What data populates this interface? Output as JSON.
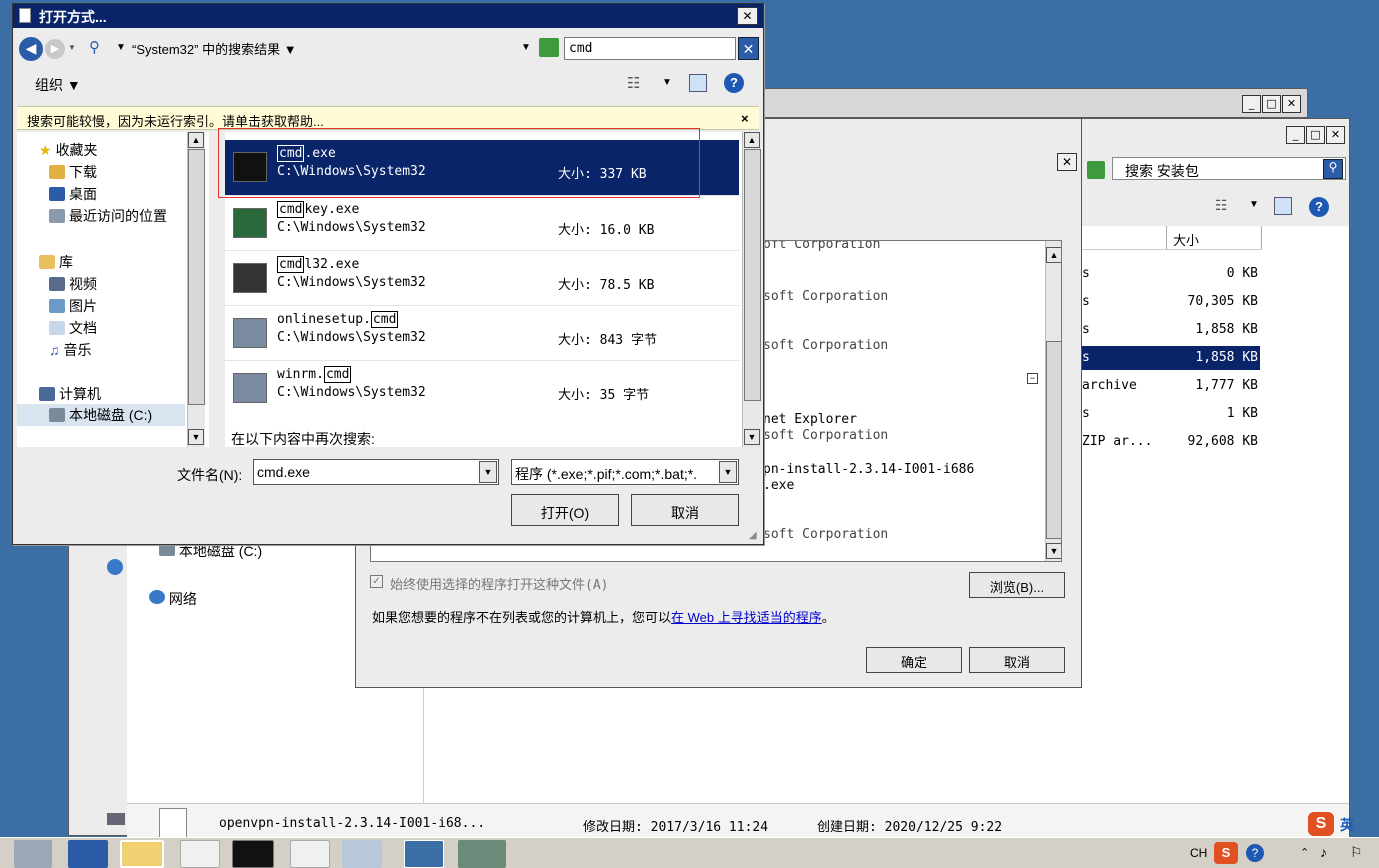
{
  "open_dialog": {
    "title": "打开方式...",
    "breadcrumb": "“System32” 中的搜索结果",
    "search_value": "cmd",
    "organize_label": "组织",
    "info_bar": "搜索可能较慢，因为未运行索引。请单击获取帮助...",
    "nav": {
      "favorites": "收藏夹",
      "downloads": "下载",
      "desktop": "桌面",
      "recent": "最近访问的位置",
      "libraries": "库",
      "videos": "视频",
      "pictures": "图片",
      "documents": "文档",
      "music": "音乐",
      "computer": "计算机",
      "local_disk": "本地磁盘 (C:)"
    },
    "results": [
      {
        "pre": "",
        "hl": "cmd",
        "post": ".exe",
        "path": "C:\\Windows\\System32",
        "size": "大小: 337 KB"
      },
      {
        "pre": "",
        "hl": "cmd",
        "post": "key.exe",
        "path": "C:\\Windows\\System32",
        "size": "大小: 16.0 KB"
      },
      {
        "pre": "",
        "hl": "cmd",
        "post": "l32.exe",
        "path": "C:\\Windows\\System32",
        "size": "大小: 78.5 KB"
      },
      {
        "pre": "onlinesetup.",
        "hl": "cmd",
        "post": "",
        "path": "C:\\Windows\\System32",
        "size": "大小: 843 字节"
      },
      {
        "pre": "winrm.",
        "hl": "cmd",
        "post": "",
        "path": "C:\\Windows\\System32",
        "size": "大小: 35 字节"
      }
    ],
    "search_again": "在以下内容中再次搜索:",
    "filename_label": "文件名(N):",
    "filename_value": "cmd.exe",
    "filter_value": "程序 (*.exe;*.pif;*.com;*.bat;*.",
    "open_button": "打开(O)",
    "cancel_button": "取消"
  },
  "openwith_dialog": {
    "list_fragments": [
      "oft Corporation",
      "soft Corporation",
      "soft Corporation",
      "net Explorer",
      "soft Corporation",
      "pn-install-2.3.14-I001-i686",
      ".exe",
      "soft Corporation"
    ],
    "always_use": "始终使用选择的程序打开这种文件(A)",
    "browse_button": "浏览(B)...",
    "hint_text": "如果您想要的程序不在列表或您的计算机上，您可以",
    "hint_link": "在 Web 上寻找适当的程序",
    "hint_end": "。",
    "ok_button": "确定",
    "cancel_button": "取消"
  },
  "explorer": {
    "search_placeholder": "搜索 安装包",
    "col_size": "大小",
    "files": [
      {
        "name": "s",
        "size": "0 KB"
      },
      {
        "name": "s",
        "size": "70,305 KB"
      },
      {
        "name": "s",
        "size": "1,858 KB"
      },
      {
        "name": "s",
        "size": "1,858 KB"
      },
      {
        "name": "archive",
        "size": "1,777 KB"
      },
      {
        "name": "s",
        "size": "1 KB"
      },
      {
        "name": "ZIP ar...",
        "size": "92,608 KB"
      }
    ],
    "nav_local_disk": "本地磁盘 (C:)",
    "nav_network": "网络",
    "status_name": "openvpn-install-2.3.14-I001-i68...",
    "status_modified": "修改日期: 2017/3/16 11:24",
    "status_created": "创建日期: 2020/12/25 9:22"
  },
  "taskbar": {
    "lang": "CH",
    "ime": "英"
  },
  "colors": {
    "desktop": "#3a6ea5",
    "selection": "#0a246a",
    "highlight_box": "#e03030"
  }
}
